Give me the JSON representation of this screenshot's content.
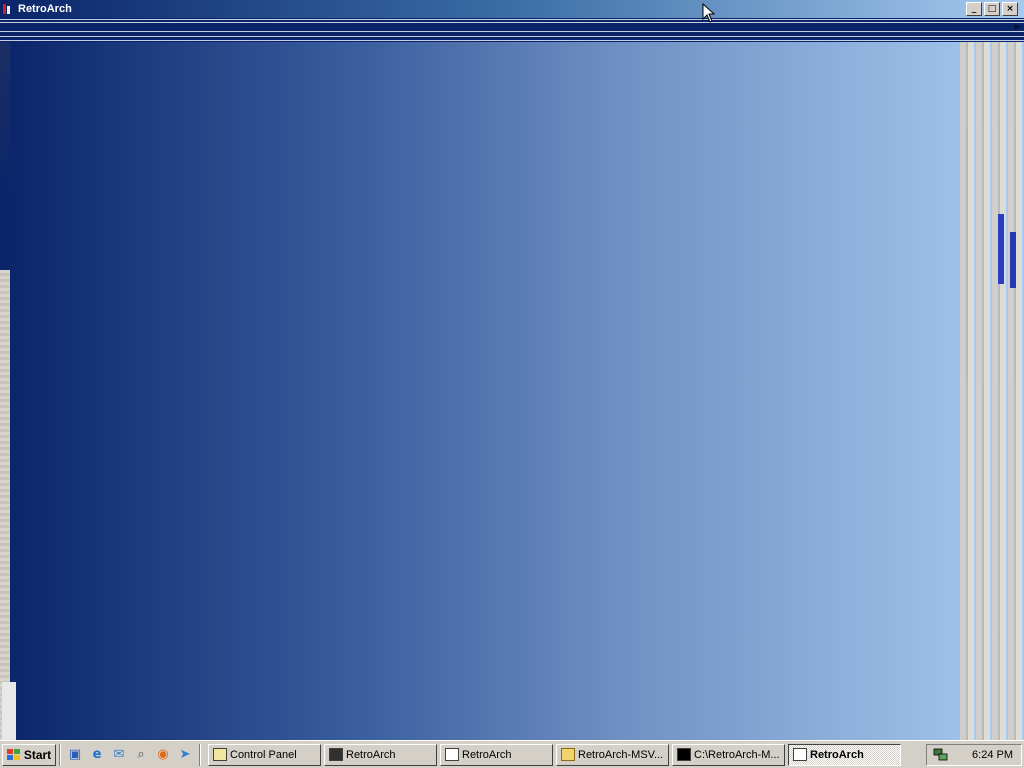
{
  "window": {
    "title": "RetroArch",
    "buttons": {
      "minimize": "_",
      "maximize": "□",
      "close": "×"
    },
    "menu_chevron": "»",
    "gradient_colors": [
      "#0a246a",
      "#a6caf0"
    ]
  },
  "taskbar": {
    "start_label": "Start",
    "quick_launch": [
      {
        "icon": "show-desktop-icon"
      },
      {
        "icon": "internet-explorer-icon"
      },
      {
        "icon": "outlook-icon"
      },
      {
        "icon": "search-icon"
      },
      {
        "icon": "firefox-icon"
      },
      {
        "icon": "media-icon"
      }
    ],
    "tasks": [
      {
        "label": "Control Panel",
        "icon": "control-panel-icon",
        "active": false
      },
      {
        "label": "RetroArch",
        "icon": "retroarch-icon",
        "active": false
      },
      {
        "label": "RetroArch",
        "icon": "retroarch-window-icon",
        "active": false
      },
      {
        "label": "RetroArch-MSV...",
        "icon": "folder-icon",
        "active": false
      },
      {
        "label": "C:\\RetroArch-M...",
        "icon": "console-icon",
        "active": false
      },
      {
        "label": "RetroArch",
        "icon": "retroarch-window-icon",
        "active": true
      }
    ],
    "tray": {
      "icon": "network-icon",
      "clock": "6:24 PM"
    }
  }
}
